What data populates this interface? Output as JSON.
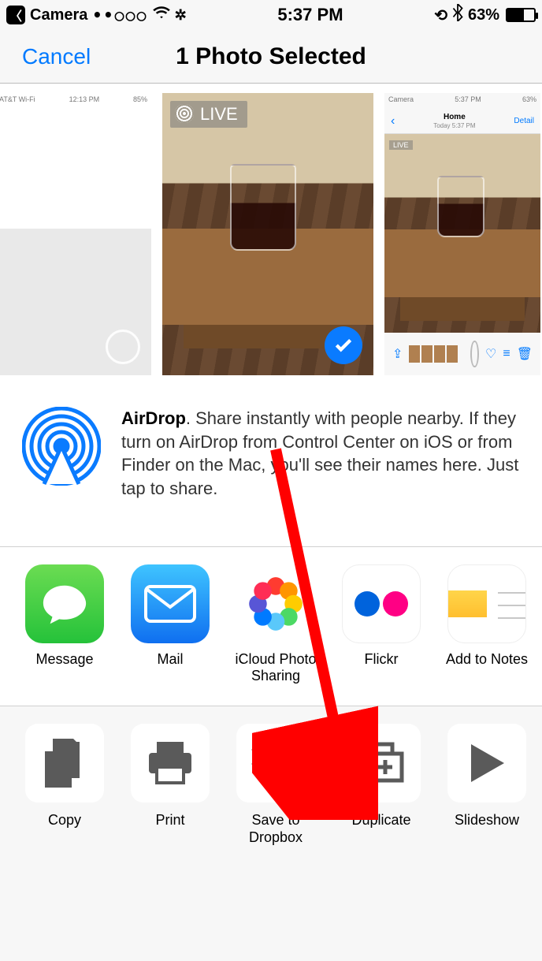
{
  "status_bar": {
    "back_label": "Camera",
    "signal_dots": "••○○○",
    "time": "5:37 PM",
    "battery_pct": "63%"
  },
  "nav": {
    "cancel": "Cancel",
    "title": "1 Photo Selected"
  },
  "photos": {
    "thumb_a": {
      "mini_carrier": "AT&T Wi-Fi",
      "mini_time": "12:13 PM",
      "mini_batt": "85%"
    },
    "thumb_b": {
      "live_badge": "LIVE",
      "selected": true
    },
    "thumb_c": {
      "mini_app": "Camera",
      "mini_time": "5:37 PM",
      "mini_batt": "63%",
      "mini_title": "Home",
      "mini_subtitle": "Today 5:37 PM",
      "mini_detail": "Detail",
      "mini_live": "LIVE"
    }
  },
  "airdrop": {
    "bold": "AirDrop",
    "text": ". Share instantly with people nearby. If they turn on AirDrop from Control Center on iOS or from Finder on the Mac, you'll see their names here. Just tap to share."
  },
  "share_apps": {
    "message": "Message",
    "mail": "Mail",
    "icloud": "iCloud Photo Sharing",
    "flickr": "Flickr",
    "notes": "Add to Notes"
  },
  "actions": {
    "copy": "Copy",
    "print": "Print",
    "dropbox": "Save to Dropbox",
    "duplicate": "Duplicate",
    "slideshow": "Slideshow"
  }
}
